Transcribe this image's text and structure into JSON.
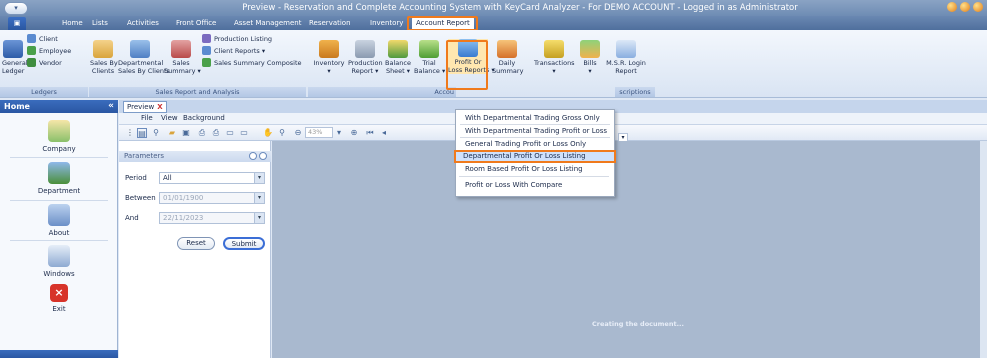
{
  "window": {
    "title": "Preview - Reservation and Complete Accounting System with KeyCard Analyzer - For DEMO ACCOUNT - Logged in as Administrator"
  },
  "tabs": [
    "Home",
    "Lists",
    "Activities",
    "Front Office",
    "Asset Management",
    "Reservation",
    "Inventory",
    "Account Report"
  ],
  "ribbon": {
    "ledgers": {
      "general_ledger": "General\nLedger",
      "client": "Client",
      "employee": "Employee",
      "vendor": "Vendor",
      "group": "Ledgers"
    },
    "sales": {
      "sales_by_clients": "Sales By\nClients",
      "departmental": "Departmental\nSales By Clients",
      "sales_summary": "Sales\nSummary ▾",
      "production_listing": "Production Listing",
      "client_reports": "Client Reports ▾",
      "sales_summary_composite": "Sales Summary Composite",
      "group": "Sales Report and Analysis"
    },
    "accounts": {
      "inventory": "Inventory\n▾",
      "production_report": "Production\nReport ▾",
      "balance_sheet": "Balance\nSheet ▾",
      "trial_balance": "Trial\nBalance ▾",
      "profit_or_loss": "Profit Or\nLoss Reports ▾",
      "daily_summary": "Daily\nSummary",
      "transactions": "Transactions\n▾",
      "bills": "Bills\n▾",
      "msr_login": "M.S.R. Login\nReport",
      "group_accounts": "Accou",
      "group_descriptions": "scriptions"
    }
  },
  "dropdown": {
    "items": [
      "With Departmental Trading Gross Only",
      "With Departmental Trading Profit or Loss",
      "General Trading Profit or Loss Only",
      "Departmental Profit Or Loss Listing",
      "Room Based Profit Or Loss Listing",
      "Profit or Loss With Compare"
    ]
  },
  "sidebar": {
    "title": "Home",
    "collapse": "«",
    "items": [
      "Company",
      "Department",
      "About",
      "Windows",
      "Exit"
    ]
  },
  "document": {
    "tab": "Preview",
    "close": "X",
    "menu": [
      "File",
      "View",
      "Background"
    ],
    "zoom": "43%",
    "status": "Creating the document..."
  },
  "parameters": {
    "title": "Parameters",
    "period_label": "Period",
    "period_value": "All",
    "between_label": "Between",
    "between_value": "01/01/1900",
    "and_label": "And",
    "and_value": "22/11/2023",
    "reset": "Reset",
    "submit": "Submit"
  },
  "colors": {
    "highlight": "#f07a1c",
    "accent": "#2a57a3"
  }
}
